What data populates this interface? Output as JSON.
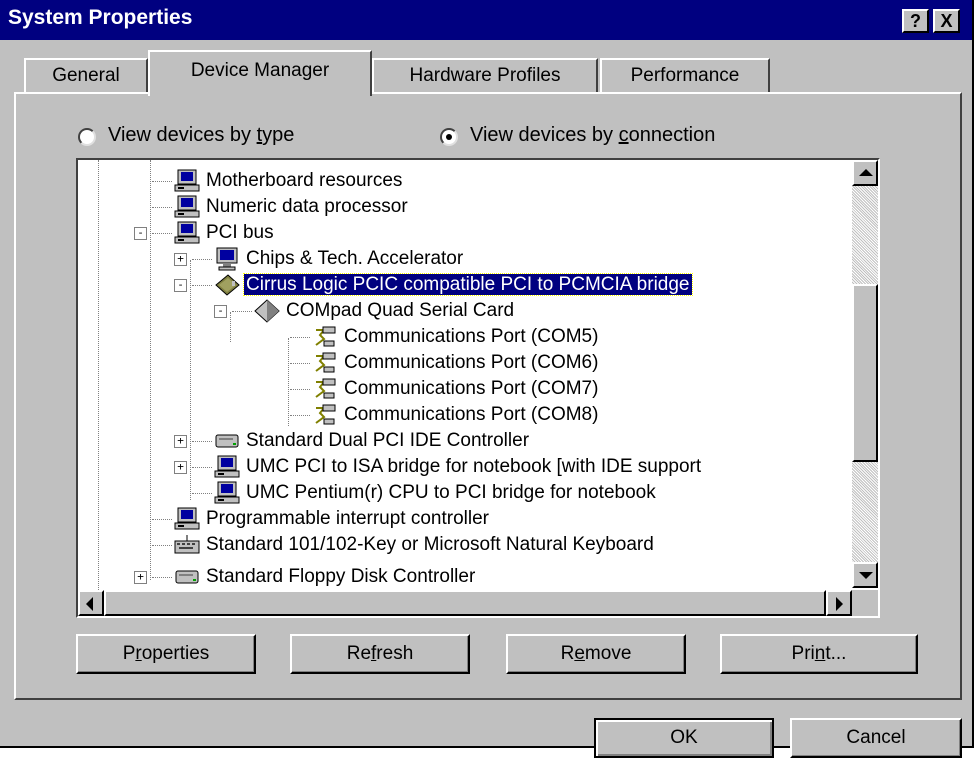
{
  "window": {
    "title": "System Properties",
    "help_label": "?",
    "close_label": "X"
  },
  "tabs": [
    {
      "label": "General"
    },
    {
      "label": "Device Manager"
    },
    {
      "label": "Hardware Profiles"
    },
    {
      "label": "Performance"
    }
  ],
  "view_options": {
    "by_type": {
      "pre": "View devices by ",
      "key": "t",
      "post": "ype",
      "selected": false
    },
    "by_connection": {
      "pre": "View devices by ",
      "key": "c",
      "post": "onnection",
      "selected": true
    }
  },
  "tree_items": [
    {
      "label": "Motherboard resources",
      "icon": "computer-icon"
    },
    {
      "label": "Numeric data processor",
      "icon": "computer-icon"
    },
    {
      "label": "PCI bus",
      "icon": "computer-icon"
    },
    {
      "label": "Chips & Tech. Accelerator",
      "icon": "monitor-icon"
    },
    {
      "label": "Cirrus Logic PCIC compatible PCI to PCMCIA bridge",
      "icon": "pcmcia-card-icon",
      "selected": true
    },
    {
      "label": "COMpad Quad Serial Card",
      "icon": "diamond-icon"
    },
    {
      "label": "Communications Port (COM5)",
      "icon": "port-icon"
    },
    {
      "label": "Communications Port (COM6)",
      "icon": "port-icon"
    },
    {
      "label": "Communications Port (COM7)",
      "icon": "port-icon"
    },
    {
      "label": "Communications Port (COM8)",
      "icon": "port-icon"
    },
    {
      "label": "Standard Dual PCI IDE Controller",
      "icon": "drive-icon"
    },
    {
      "label": "UMC PCI to ISA bridge for notebook [with IDE support",
      "icon": "computer-icon"
    },
    {
      "label": "UMC Pentium(r) CPU to PCI bridge for notebook",
      "icon": "computer-icon"
    },
    {
      "label": "Programmable interrupt controller",
      "icon": "computer-icon"
    },
    {
      "label": "Standard 101/102-Key or Microsoft Natural Keyboard",
      "icon": "keyboard-icon"
    },
    {
      "label": "Standard Floppy Disk Controller",
      "icon": "drive-icon"
    }
  ],
  "buttons": {
    "properties": {
      "pre": "P",
      "key": "r",
      "post": "operties"
    },
    "refresh": {
      "pre": "Re",
      "key": "f",
      "post": "resh"
    },
    "remove": {
      "pre": "R",
      "key": "e",
      "post": "move"
    },
    "print": {
      "pre": "Pri",
      "key": "n",
      "post": "t..."
    },
    "ok": "OK",
    "cancel": "Cancel"
  },
  "colors": {
    "titlebar": "#000080",
    "face": "#c0c0c0",
    "selection": "#000080"
  }
}
